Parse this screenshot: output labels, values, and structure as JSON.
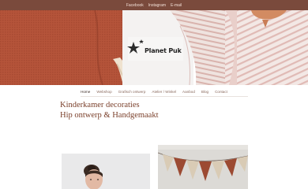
{
  "topbar": {
    "links": [
      "Facebook",
      "Instagram",
      "E-mail"
    ]
  },
  "logo": {
    "text": "Planet Puk"
  },
  "nav": {
    "items": [
      "Home",
      "Webshop",
      "Grafisch ontwerp",
      "Atelier / Winkel",
      "Aanbod",
      "Blog",
      "Contact"
    ],
    "active": "Home"
  },
  "headline": {
    "line1": "Kinderkamer decoraties",
    "line2": "Hip ontwerp & Handgemaakt"
  },
  "colors": {
    "topbar": "#7a4a3c",
    "accent": "#7a3f2a",
    "nav_text": "#8a6a5e"
  }
}
